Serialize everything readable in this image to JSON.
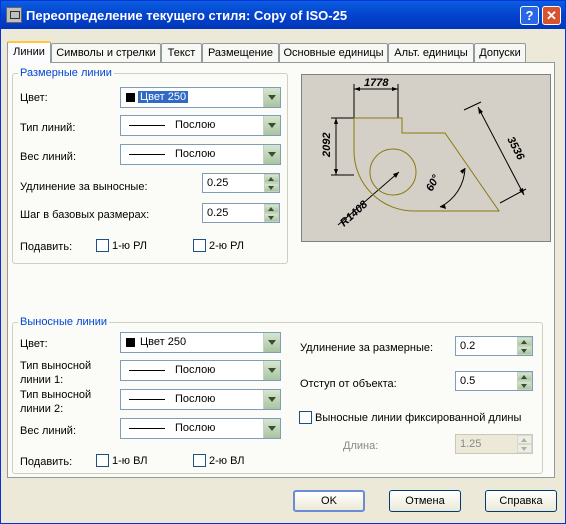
{
  "window": {
    "title": "Переопределение текущего стиля: Copy of ISO-25",
    "help": "?",
    "close": "✕"
  },
  "tabs": [
    {
      "label": "Линии",
      "active": true
    },
    {
      "label": "Символы и стрелки"
    },
    {
      "label": "Текст"
    },
    {
      "label": "Размещение"
    },
    {
      "label": "Основные единицы"
    },
    {
      "label": "Альт. единицы"
    },
    {
      "label": "Допуски"
    }
  ],
  "dim_lines": {
    "title": "Размерные линии",
    "color_label": "Цвет:",
    "color_value": "Цвет 250",
    "linetype_label": "Тип линий:",
    "linetype_value": "Послою",
    "lineweight_label": "Вес линий:",
    "lineweight_value": "Послою",
    "extend_label": "Удлинение за выносные:",
    "extend_value": "0.25",
    "baseline_label": "Шаг в базовых размерах:",
    "baseline_value": "0.25",
    "suppress_label": "Подавить:",
    "suppress_1": "1-ю РЛ",
    "suppress_2": "2-ю РЛ"
  },
  "ext_lines": {
    "title": "Выносные линии",
    "color_label": "Цвет:",
    "color_value": "Цвет 250",
    "linetype1_label_a": "Тип выносной",
    "linetype1_label_b": "линии 1:",
    "linetype1_value": "Послою",
    "linetype2_label_a": "Тип выносной",
    "linetype2_label_b": "линии 2:",
    "linetype2_value": "Послою",
    "lineweight_label": "Вес линий:",
    "lineweight_value": "Послою",
    "suppress_label": "Подавить:",
    "suppress_1": "1-ю ВЛ",
    "suppress_2": "2-ю ВЛ",
    "extend_label": "Удлинение за размерные:",
    "extend_value": "0.2",
    "offset_label": "Отступ от объекта:",
    "offset_value": "0.5",
    "fixed_label": "Выносные линии фиксированной длины",
    "length_label": "Длина:",
    "length_value": "1.25"
  },
  "preview": {
    "dim_top": "1778",
    "dim_left": "2092",
    "dim_diag": "3536",
    "angle": "60°",
    "radius": "R1408"
  },
  "buttons": {
    "ok": "OK",
    "cancel": "Отмена",
    "help": "Справка"
  }
}
